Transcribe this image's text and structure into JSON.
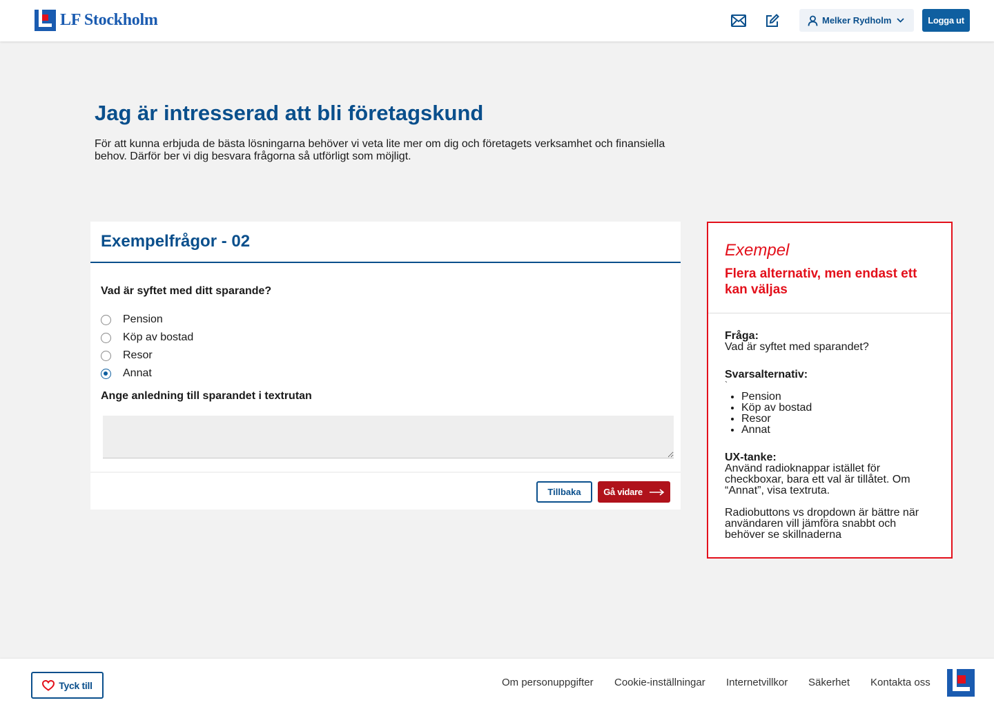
{
  "header": {
    "brand_name": "LF Stockholm",
    "user_name": "Melker Rydholm",
    "logout_label": "Logga ut",
    "icons": [
      "mail-icon",
      "edit-icon",
      "user-icon",
      "chevron-down-icon"
    ]
  },
  "intro": {
    "title": "Jag är intresserad att bli företagskund",
    "text": "För att kunna erbjuda de bästa lösningarna behöver vi veta lite mer om dig och företagets verksamhet och finansiella behov. Därför ber vi dig besvara frågorna så utförligt som möjligt."
  },
  "form": {
    "title": "Exempelfrågor - 02",
    "question": "Vad är syftet med ditt sparande?",
    "options": [
      {
        "label": "Pension",
        "checked": false
      },
      {
        "label": "Köp av bostad",
        "checked": false
      },
      {
        "label": "Resor",
        "checked": false
      },
      {
        "label": "Annat",
        "checked": true
      }
    ],
    "text_label": "Ange anledning till sparandet i textrutan",
    "text_value": "",
    "back_label": "Tillbaka",
    "next_label": "Gå vidare"
  },
  "example": {
    "kicker": "Exempel",
    "heading": "Flera alternativ, men endast ett kan väljas",
    "question_label": "Fråga:",
    "question_text": "Vad är syftet med sparandet?",
    "options_label": "Svarsalternativ:",
    "stray_mark": "`",
    "options": [
      "Pension",
      "Köp av bostad",
      "Resor",
      "Annat"
    ],
    "ux_label": "UX-tanke:",
    "ux_text_1": "Använd radioknappar istället för checkboxar, bara ett val är tillåtet. Om “Annat”, visa textruta.",
    "ux_text_2": "Radiobuttons vs dropdown är bättre när användaren vill jämföra snabbt och behöver se skillnaderna"
  },
  "footer": {
    "feedback_label": "Tyck till",
    "links": [
      "Om personuppgifter",
      "Cookie-inställningar",
      "Internetvillkor",
      "Säkerhet",
      "Kontakta oss"
    ]
  },
  "colors": {
    "brand_blue": "#0a4f8c",
    "button_blue": "#0f5fa0",
    "accent_red": "#e3101b",
    "next_red": "#b0121b",
    "page_bg": "#f2f2f2"
  }
}
